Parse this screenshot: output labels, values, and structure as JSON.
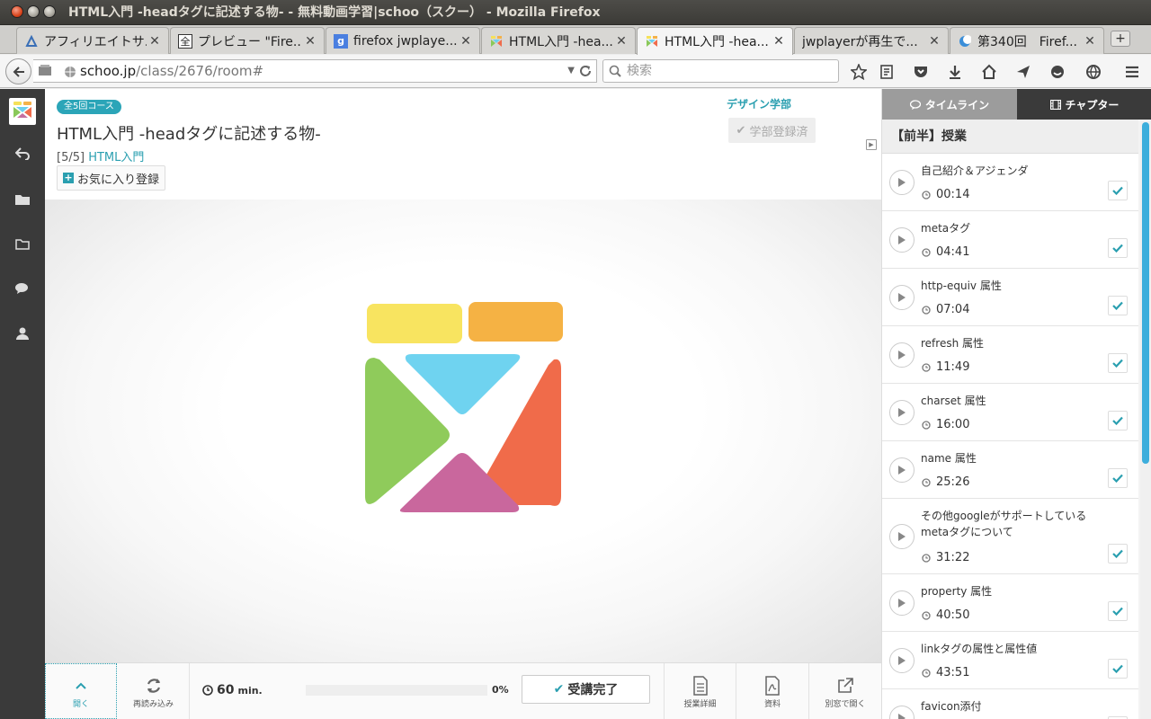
{
  "window": {
    "title": "HTML入門 -headタグに記述する物- - 無料動画学習|schoo（スクー） - Mozilla Firefox"
  },
  "tabs": [
    {
      "label": "アフィリエイトサ...",
      "favicon": "affiliate-icon"
    },
    {
      "label": "プレビュー \"Fire...",
      "favicon": "kanji-icon",
      "favicon_text": "全"
    },
    {
      "label": "firefox jwplaye...",
      "favicon": "google-icon",
      "favicon_text": "g"
    },
    {
      "label": "HTML入門 -hea...",
      "favicon": "schoo-icon"
    },
    {
      "label": "HTML入門 -hea...",
      "favicon": "schoo-icon",
      "active": true
    },
    {
      "label": "jwplayerが再生で...",
      "favicon": "none"
    },
    {
      "label": "第340回　Firef...",
      "favicon": "moon-icon"
    }
  ],
  "newtab": "+",
  "urlbar": {
    "domain": "schoo.jp",
    "path": "/class/2676/room#"
  },
  "search": {
    "placeholder": "検索"
  },
  "course": {
    "badge": "全5回コース",
    "title": "HTML入門 -headタグに記述する物-",
    "position": "[5/5]",
    "course_link": "HTML入門",
    "favorite_label": "お気に入り登録",
    "department": "デザイン学部",
    "department_button": "学部登録済"
  },
  "bottom": {
    "open_label": "開く",
    "reload_label": "再読み込み",
    "duration": "60",
    "duration_unit": "min.",
    "progress": 0,
    "progress_label": "0%",
    "complete_label": "受講完了",
    "details_label": "授業詳細",
    "materials_label": "資料",
    "popout_label": "別窓で開く"
  },
  "panel": {
    "tab_timeline": "タイムライン",
    "tab_chapter": "チャプター",
    "section": "【前半】授業",
    "chapters": [
      {
        "title": "自己紹介＆アジェンダ",
        "time": "00:14"
      },
      {
        "title": "metaタグ",
        "time": "04:41"
      },
      {
        "title": "http-equiv 属性",
        "time": "07:04"
      },
      {
        "title": "refresh 属性",
        "time": "11:49"
      },
      {
        "title": "charset 属性",
        "time": "16:00"
      },
      {
        "title": "name 属性",
        "time": "25:26"
      },
      {
        "title": "その他googleがサポートしているmetaタグについて",
        "time": "31:22"
      },
      {
        "title": "property 属性",
        "time": "40:50"
      },
      {
        "title": "linkタグの属性と属性値",
        "time": "43:51"
      },
      {
        "title": "favicon添付",
        "time": ""
      }
    ]
  },
  "colors": {
    "accent": "#2a9fb0",
    "sidebar": "#3a3a3a",
    "scrollbar": "#3daedc"
  }
}
